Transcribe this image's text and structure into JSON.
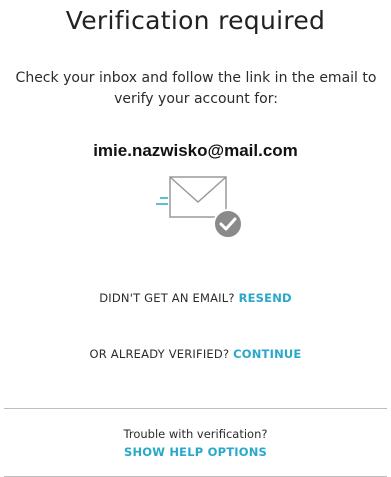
{
  "page": {
    "title": "Verification required",
    "instructions": "Check your inbox and follow the link in the email to verify your account for:",
    "email": "imie.nazwisko@mail.com"
  },
  "resend": {
    "prompt": "DIDN'T GET AN EMAIL?",
    "link_label": "RESEND"
  },
  "continue": {
    "prompt": "OR ALREADY VERIFIED?",
    "link_label": "CONTINUE"
  },
  "help": {
    "prompt": "Trouble with verification?",
    "link_label": "SHOW HELP OPTIONS"
  },
  "icons": {
    "illustration": "envelope-check-icon"
  },
  "colors": {
    "link": "#29a8c9",
    "text": "#2b2b2b",
    "check_badge": "#8a8a8a",
    "divider": "#bdbdbd"
  }
}
